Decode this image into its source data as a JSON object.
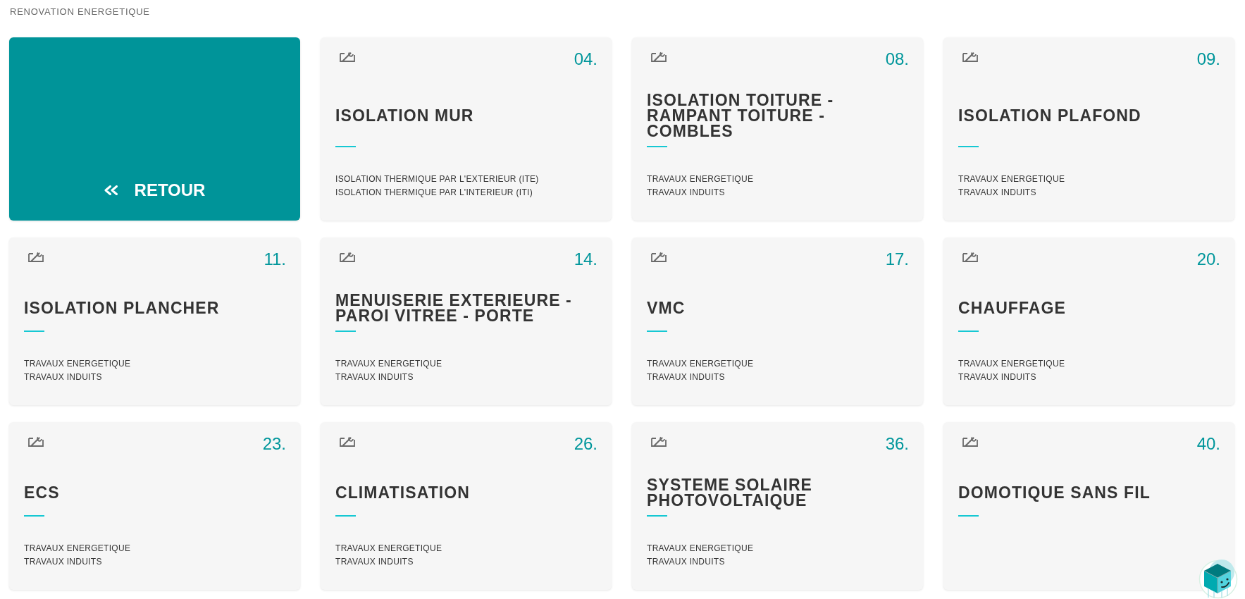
{
  "page": {
    "title": "RENOVATION ENERGETIQUE"
  },
  "back_button": {
    "label": "RETOUR"
  },
  "categories": [
    {
      "number": "04.",
      "title": "ISOLATION MUR",
      "items": [
        "ISOLATION THERMIQUE PAR L'EXTERIEUR (ITE)",
        "ISOLATION THERMIQUE PAR L'INTERIEUR (ITI)"
      ]
    },
    {
      "number": "08.",
      "title": "ISOLATION TOITURE - RAMPANT TOITURE - COMBLES",
      "items": [
        "TRAVAUX ENERGETIQUE",
        "TRAVAUX INDUITS"
      ]
    },
    {
      "number": "09.",
      "title": "ISOLATION PLAFOND",
      "items": [
        "TRAVAUX ENERGETIQUE",
        "TRAVAUX INDUITS"
      ]
    },
    {
      "number": "11.",
      "title": "ISOLATION PLANCHER",
      "items": [
        "TRAVAUX ENERGETIQUE",
        "TRAVAUX INDUITS"
      ]
    },
    {
      "number": "14.",
      "title": "MENUISERIE EXTERIEURE - PAROI VITREE - PORTE",
      "items": [
        "TRAVAUX ENERGETIQUE",
        "TRAVAUX INDUITS"
      ]
    },
    {
      "number": "17.",
      "title": "VMC",
      "items": [
        "TRAVAUX ENERGETIQUE",
        "TRAVAUX INDUITS"
      ]
    },
    {
      "number": "20.",
      "title": "CHAUFFAGE",
      "items": [
        "TRAVAUX ENERGETIQUE",
        "TRAVAUX INDUITS"
      ]
    },
    {
      "number": "23.",
      "title": "ECS",
      "items": [
        "TRAVAUX ENERGETIQUE",
        "TRAVAUX INDUITS"
      ]
    },
    {
      "number": "26.",
      "title": "CLIMATISATION",
      "items": [
        "TRAVAUX ENERGETIQUE",
        "TRAVAUX INDUITS"
      ]
    },
    {
      "number": "36.",
      "title": "SYSTEME SOLAIRE PHOTOVOLTAIQUE",
      "items": [
        "TRAVAUX ENERGETIQUE",
        "TRAVAUX INDUITS"
      ]
    },
    {
      "number": "40.",
      "title": "DOMOTIQUE SANS FIL"
    }
  ]
}
